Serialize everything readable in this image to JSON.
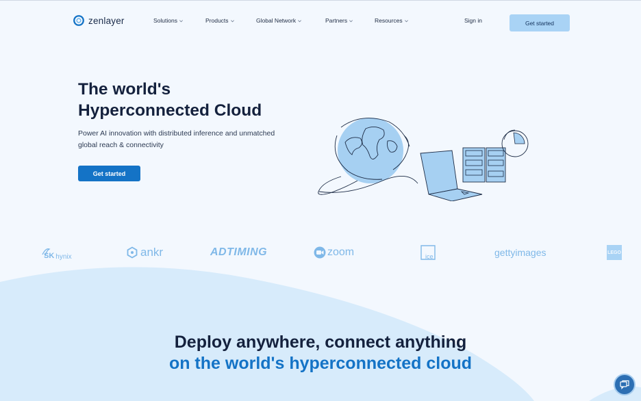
{
  "header": {
    "logo_text": "zenlayer",
    "nav": [
      {
        "label": "Solutions"
      },
      {
        "label": "Products"
      },
      {
        "label": "Global Network"
      },
      {
        "label": "Partners"
      },
      {
        "label": "Resources"
      }
    ],
    "signin_label": "Sign in",
    "cta_label": "Get started"
  },
  "hero": {
    "title_line1": "The world's",
    "title_line2": "Hyperconnected Cloud",
    "subtitle": "Power AI innovation with distributed inference and unmatched global reach & connectivity",
    "cta_label": "Get started"
  },
  "customers": {
    "skhynix_sk": "SK",
    "skhynix_name": "hynix",
    "ankr": "ankr",
    "adtiming": "ADTIMING",
    "zoom": "zoom",
    "ice": "ice",
    "gettyimages": "gettyimages",
    "lego": "LEGO"
  },
  "section": {
    "heading_line1": "Deploy anywhere, connect anything",
    "heading_line2": "on the world's hyperconnected cloud"
  },
  "colors": {
    "primary": "#1473c6",
    "accent_light": "#a9d3f5",
    "background": "#f3f8fe",
    "text_dark": "#14213d"
  },
  "icons": {
    "nav_chevron": "chevron-down-icon",
    "chat": "chat-icon"
  }
}
